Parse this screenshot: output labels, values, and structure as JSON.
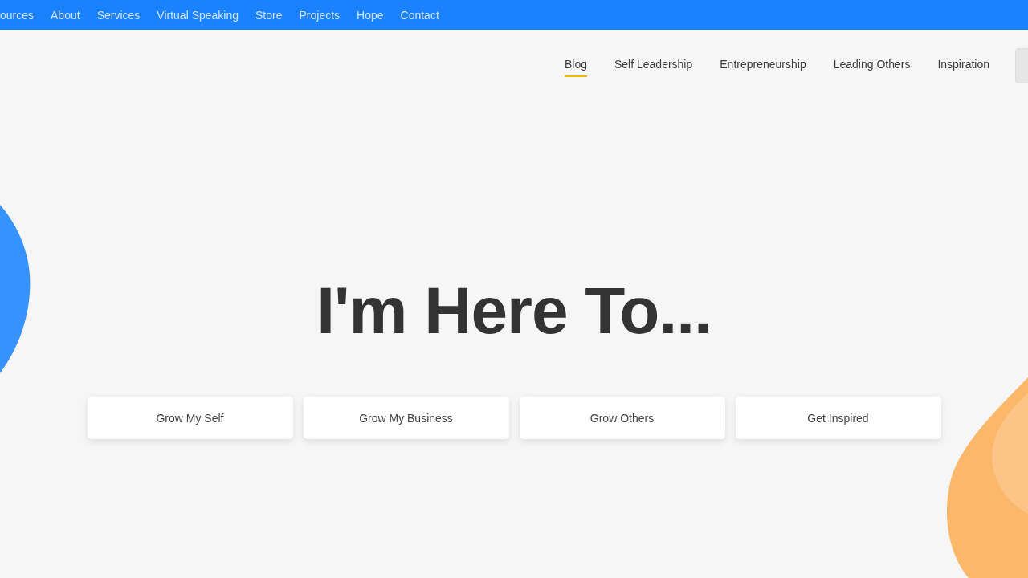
{
  "top_nav": [
    {
      "label": "ources"
    },
    {
      "label": "About"
    },
    {
      "label": "Services"
    },
    {
      "label": "Virtual Speaking"
    },
    {
      "label": "Store"
    },
    {
      "label": "Projects"
    },
    {
      "label": "Hope"
    },
    {
      "label": "Contact"
    }
  ],
  "category_nav": [
    {
      "label": "Blog",
      "selected": true
    },
    {
      "label": "Self Leadership",
      "selected": false
    },
    {
      "label": "Entrepreneurship",
      "selected": false
    },
    {
      "label": "Leading Others",
      "selected": false
    },
    {
      "label": "Inspiration",
      "selected": false
    }
  ],
  "hero": {
    "heading": "I'm Here To...",
    "buttons": [
      "Grow My Self",
      "Grow My Business",
      "Grow Others",
      "Get Inspired"
    ]
  }
}
